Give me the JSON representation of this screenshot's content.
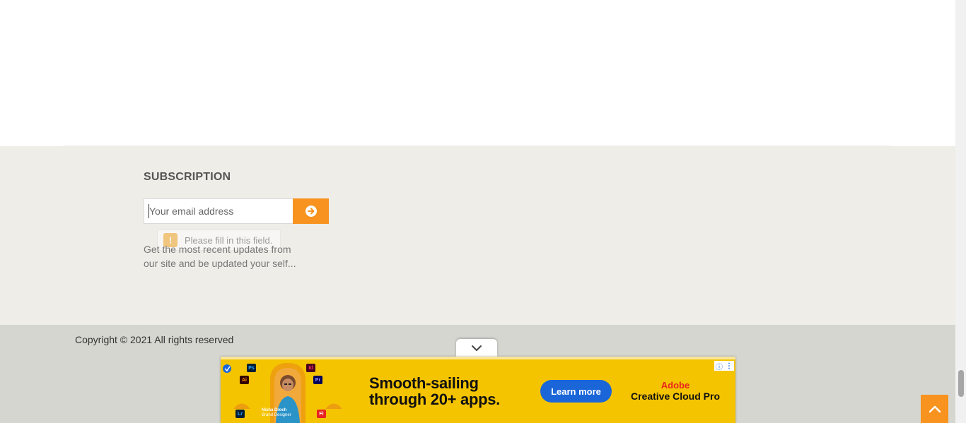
{
  "subscription": {
    "title": "SUBSCRIPTION",
    "email_placeholder": "Your email address",
    "validation_tooltip": "Please fill in this field.",
    "description": "Get the most recent updates from our site and be updated your self..."
  },
  "footer": {
    "copyright": "Copyright © 2021 All rights reserved"
  },
  "ad": {
    "headline_line1": "Smooth-sailing",
    "headline_line2": "through 20+ apps.",
    "cta_label": "Learn more",
    "brand_line1": "Adobe",
    "brand_line2": "Creative Cloud Pro",
    "person_name": "Nisha Droch",
    "person_title": "Brand Designer",
    "app_chips": [
      "Ps",
      "Id",
      "Ai",
      "Pr",
      "Lr",
      "Fi"
    ],
    "colors": {
      "background": "#f5c400",
      "cta": "#1a66d9",
      "brand_red": "#e8231f"
    }
  },
  "colors": {
    "accent": "#f7931e",
    "subscription_bg": "#efede7",
    "footer_bg": "#d6d6d1"
  },
  "icons": {
    "submit": "arrow-circle-right-icon",
    "ad_toggle": "chevron-down-icon",
    "back_to_top": "chevron-up-icon",
    "ad_info": "info-icon",
    "ad_menu": "kebab-menu-icon",
    "warning": "warning-icon"
  }
}
